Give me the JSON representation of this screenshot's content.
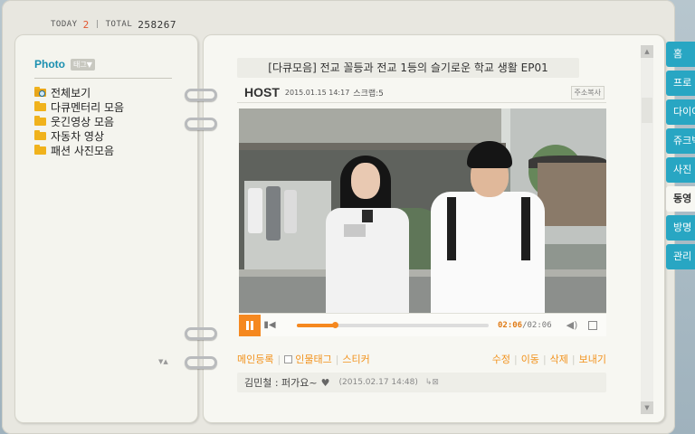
{
  "counter": {
    "today_label": "TODAY",
    "today_value": "2",
    "total_label": "TOTAL",
    "total_value": "258267",
    "separator": "|"
  },
  "sidebar": {
    "title": "Photo",
    "tag_button": "태그▼",
    "folders": [
      {
        "label": "전체보기",
        "icon": "search-folder-icon"
      },
      {
        "label": "다큐멘터리 모음",
        "icon": "folder-icon"
      },
      {
        "label": "웃긴영상 모음",
        "icon": "folder-icon"
      },
      {
        "label": "자동차 영상",
        "icon": "folder-icon"
      },
      {
        "label": "패션 사진모음",
        "icon": "folder-icon"
      }
    ],
    "scroll_arrows": "▼▲"
  },
  "post": {
    "title": "[다큐모음] 전교 꼴등과 전교 1등의 슬기로운 학교 생활 EP01",
    "author": "HOST",
    "date": "2015.01.15 14:17",
    "scrap": "스크랩:5",
    "address_copy": "주소복사"
  },
  "player": {
    "current_time": "02:06",
    "separator": "/",
    "total_time": "02:06",
    "progress": 0.2,
    "accent": "#f5881f"
  },
  "actions": {
    "left": [
      "메인등록",
      "인물태그",
      "스티커"
    ],
    "right": [
      "수정",
      "이동",
      "삭제",
      "보내기"
    ],
    "separator": "|"
  },
  "comment": {
    "author_text": "김민철 : 퍼가요~",
    "heart": "♥",
    "date": "(2015.02.17 14:48)",
    "reply_icon": "↳⊠"
  },
  "tabs": [
    "홈",
    "프로",
    "다이어",
    "쥬크박",
    "사진",
    "동영",
    "방명",
    "관리"
  ],
  "active_tab": 5,
  "colors": {
    "tab": "#28a6c3",
    "title_blue": "#1a8fb0",
    "orange": "#f2921c"
  }
}
